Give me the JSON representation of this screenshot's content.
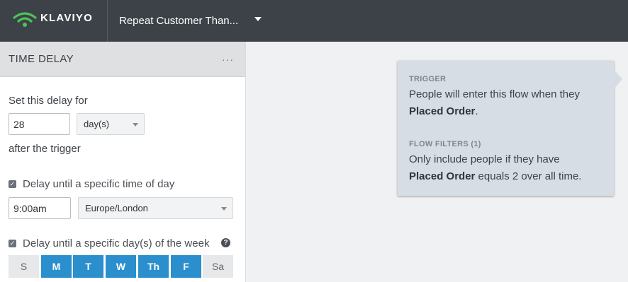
{
  "header": {
    "brand": "KLAVIYO",
    "flow_name": "Repeat Customer Than..."
  },
  "panel": {
    "title": "TIME DELAY",
    "more": "···",
    "delay_prefix": "Set this delay for",
    "delay_value": "28",
    "delay_unit": "day(s)",
    "delay_suffix": "after the trigger",
    "time_of_day": {
      "checked": true,
      "label": "Delay until a specific time of day",
      "time_value": "9:00am",
      "timezone": "Europe/London"
    },
    "days_of_week": {
      "checked": true,
      "label": "Delay until a specific day(s) of the week",
      "help": "?",
      "days": [
        {
          "label": "S",
          "selected": false
        },
        {
          "label": "M",
          "selected": true
        },
        {
          "label": "T",
          "selected": true
        },
        {
          "label": "W",
          "selected": true
        },
        {
          "label": "Th",
          "selected": true
        },
        {
          "label": "F",
          "selected": true
        },
        {
          "label": "Sa",
          "selected": false
        }
      ]
    }
  },
  "trigger_card": {
    "trigger_label": "TRIGGER",
    "trigger_text_1": "People will enter this flow when they",
    "trigger_bold": "Placed Order",
    "trigger_end": ".",
    "filters_label": "FLOW FILTERS (1)",
    "filters_text_1": "Only include people if they have",
    "filters_bold": "Placed Order",
    "filters_end": " equals 2 over all time."
  },
  "colors": {
    "topbar": "#3d4248",
    "accent": "#2b8fcd",
    "logo_green": "#4cc458",
    "card_bg": "#d6dde4"
  }
}
